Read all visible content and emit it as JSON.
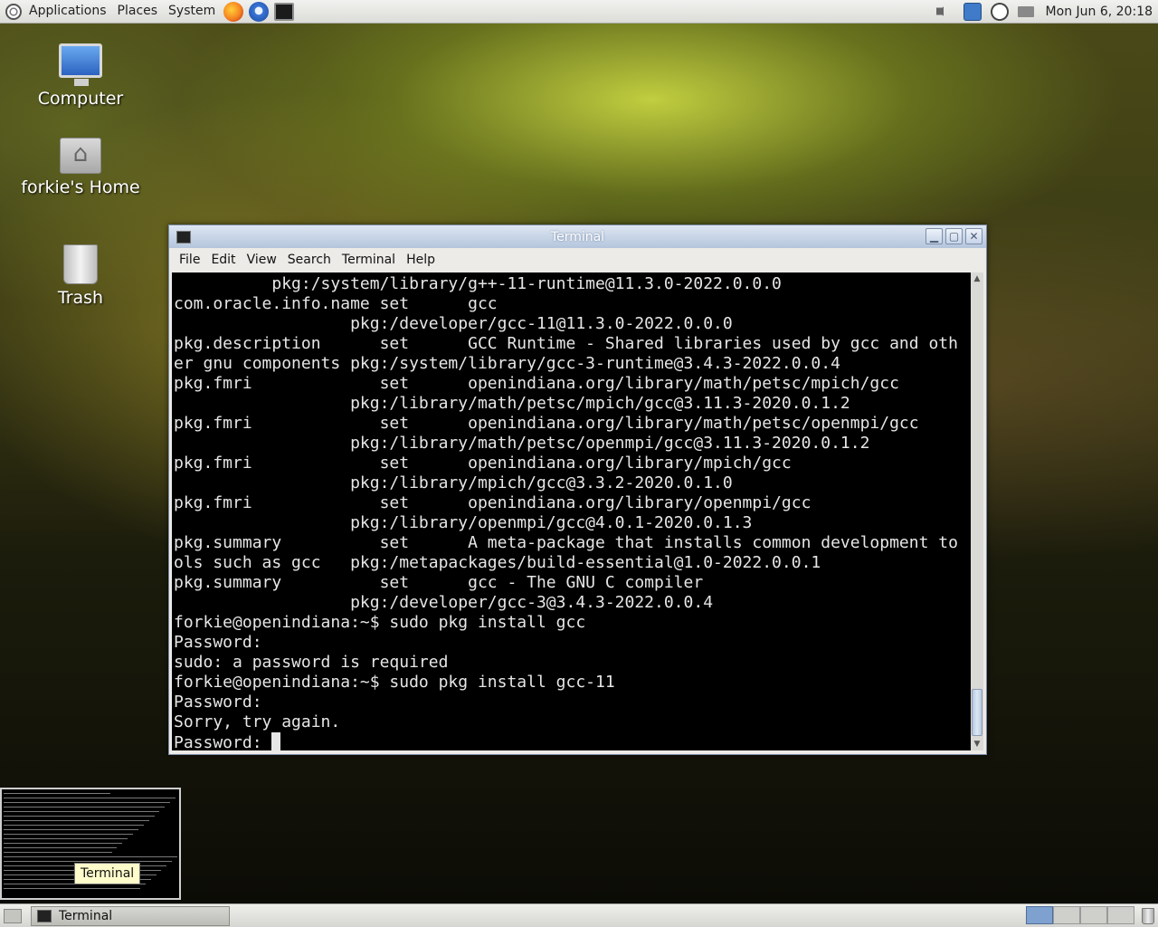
{
  "top_panel": {
    "menus": [
      "Applications",
      "Places",
      "System"
    ],
    "launchers": [
      "firefox-icon",
      "thunderbird-icon",
      "terminal-launcher-icon"
    ],
    "clock": "Mon Jun  6, 20:18"
  },
  "desktop": {
    "icons": [
      {
        "label": "Computer",
        "icon": "computer-icon"
      },
      {
        "label": "forkie's Home",
        "icon": "home-folder-icon"
      },
      {
        "label": "Trash",
        "icon": "trash-icon"
      }
    ]
  },
  "window": {
    "title": "Terminal",
    "menu": [
      "File",
      "Edit",
      "View",
      "Search",
      "Terminal",
      "Help"
    ],
    "lines": [
      "          pkg:/system/library/g++-11-runtime@11.3.0-2022.0.0.0",
      "com.oracle.info.name set      gcc",
      "                  pkg:/developer/gcc-11@11.3.0-2022.0.0.0",
      "pkg.description      set      GCC Runtime - Shared libraries used by gcc and oth",
      "er gnu components pkg:/system/library/gcc-3-runtime@3.4.3-2022.0.0.4",
      "pkg.fmri             set      openindiana.org/library/math/petsc/mpich/gcc",
      "                  pkg:/library/math/petsc/mpich/gcc@3.11.3-2020.0.1.2",
      "pkg.fmri             set      openindiana.org/library/math/petsc/openmpi/gcc",
      "                  pkg:/library/math/petsc/openmpi/gcc@3.11.3-2020.0.1.2",
      "pkg.fmri             set      openindiana.org/library/mpich/gcc",
      "                  pkg:/library/mpich/gcc@3.3.2-2020.0.1.0",
      "pkg.fmri             set      openindiana.org/library/openmpi/gcc",
      "                  pkg:/library/openmpi/gcc@4.0.1-2020.0.1.3",
      "pkg.summary          set      A meta-package that installs common development to",
      "ols such as gcc   pkg:/metapackages/build-essential@1.0-2022.0.0.1",
      "pkg.summary          set      gcc - The GNU C compiler",
      "                  pkg:/developer/gcc-3@3.4.3-2022.0.0.4",
      "forkie@openindiana:~$ sudo pkg install gcc",
      "Password:",
      "sudo: a password is required",
      "forkie@openindiana:~$ sudo pkg install gcc-11",
      "Password:",
      "Sorry, try again.",
      "Password: "
    ]
  },
  "preview_tooltip": "Terminal",
  "taskbar": {
    "task_label": "Terminal"
  },
  "colors": {
    "terminal_bg": "#000000",
    "terminal_fg": "#e6e6e6",
    "titlebar": "#b4c5dc",
    "tooltip_bg": "#fffccb"
  }
}
